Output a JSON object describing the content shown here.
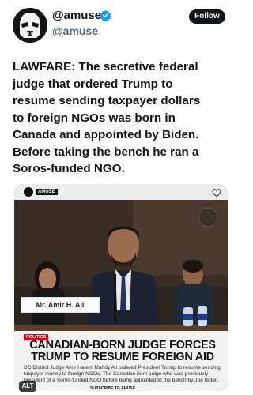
{
  "account": {
    "display_name": "@amuse",
    "handle": "@amuse",
    "follow_label": "Follow"
  },
  "tweet": {
    "text": "LAWFARE: The secretive federal judge that ordered Trump to resume sending taxpayer dollars to foreign NGOs was born in Canada and appointed by Biden. Before taking the bench he ran a Soros-funded NGO."
  },
  "media": {
    "tag": "AMUSE",
    "nameplate": "Mr. Amir H. Ali",
    "category": "POLITICS",
    "headline": "CANADIAN-BORN JUDGE FORCES TRUMP TO RESUME FOREIGN AID",
    "summary": "DC District Judge Amir Hatem Mahdy Ali ordered President Trump to resume sending taxpayer money to foreign NGOs. The Canadian born judge who was previously president of a Soros-funded NGO before being appointed to the bench by Joe Biden.",
    "footer": "SUBSCRIBE TO AMUSE",
    "alt_label": "ALT"
  },
  "colors": {
    "follow_bg": "#0f1419",
    "verified": "#1d9bf0",
    "category": "#d1001f"
  },
  "icons": {
    "avatar": "stormtrooper-avatar",
    "verified": "verified-badge-icon",
    "share": "share-icon"
  }
}
